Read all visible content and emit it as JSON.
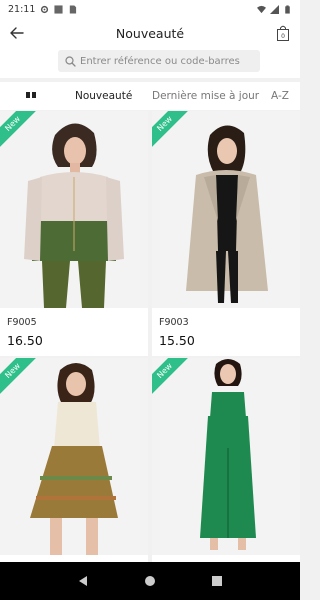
{
  "status_bar": {
    "time": "21:11"
  },
  "app_bar": {
    "title": "Nouveauté",
    "cart_count": "0"
  },
  "search": {
    "placeholder": "Entrer référence ou code-barres"
  },
  "sort_tabs": [
    "Nouveauté",
    "Dernière mise à jour",
    "A-Z"
  ],
  "colors": {
    "accent_green": "#2fbf8a",
    "nav_black": "#000000"
  },
  "products": [
    {
      "badge": "New",
      "ref": "F9005",
      "price": "16.50"
    },
    {
      "badge": "New",
      "ref": "F9003",
      "price": "15.50"
    },
    {
      "badge": "New",
      "ref": "",
      "price": ""
    },
    {
      "badge": "New",
      "ref": "",
      "price": ""
    }
  ]
}
